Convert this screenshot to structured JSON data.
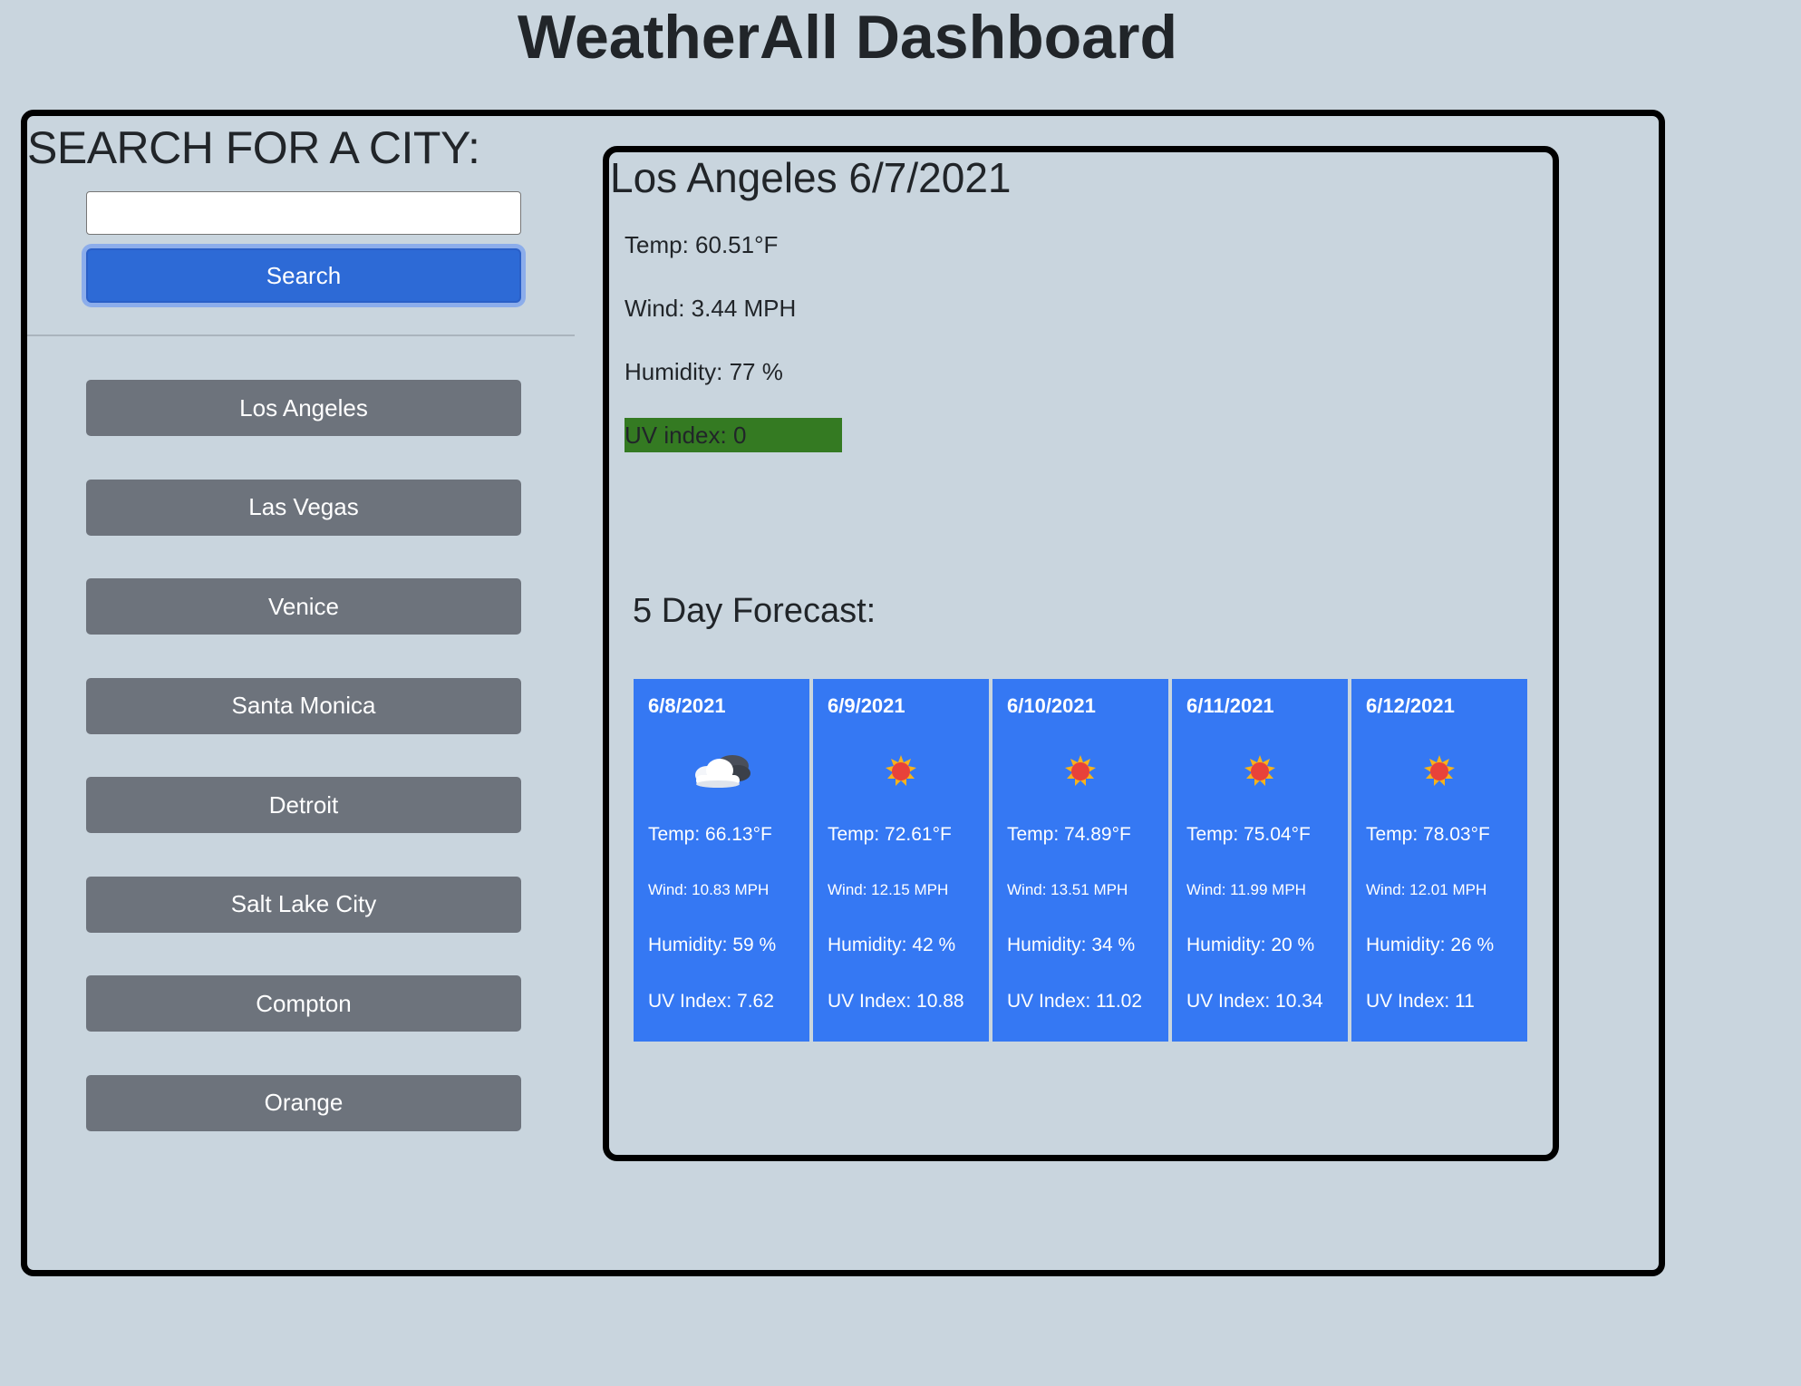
{
  "page": {
    "title": "WeatherAll Dashboard"
  },
  "search": {
    "heading": "SEARCH FOR A CITY:",
    "input_value": "",
    "input_placeholder": "",
    "button_label": "Search"
  },
  "history": [
    {
      "label": "Los Angeles"
    },
    {
      "label": "Las Vegas"
    },
    {
      "label": "Venice"
    },
    {
      "label": "Santa Monica"
    },
    {
      "label": "Detroit"
    },
    {
      "label": "Salt Lake City"
    },
    {
      "label": "Compton"
    },
    {
      "label": "Orange"
    }
  ],
  "current": {
    "heading": "Los Angeles 6/7/2021",
    "temp": "Temp: 60.51°F",
    "wind": "Wind: 3.44 MPH",
    "humidity": "Humidity: 77 %",
    "uv": "UV index: 0",
    "uv_color": "#347a22"
  },
  "forecast": {
    "heading": "5 Day Forecast:",
    "card_color": "#3578f3",
    "days": [
      {
        "date": "6/8/2021",
        "icon": "partly-cloudy-icon",
        "temp": "Temp: 66.13°F",
        "wind": "Wind: 10.83 MPH",
        "humidity": "Humidity: 59 %",
        "uv": "UV Index: 7.62"
      },
      {
        "date": "6/9/2021",
        "icon": "sun-icon",
        "temp": "Temp: 72.61°F",
        "wind": "Wind: 12.15 MPH",
        "humidity": "Humidity: 42 %",
        "uv": "UV Index: 10.88"
      },
      {
        "date": "6/10/2021",
        "icon": "sun-icon",
        "temp": "Temp: 74.89°F",
        "wind": "Wind: 13.51 MPH",
        "humidity": "Humidity: 34 %",
        "uv": "UV Index: 11.02"
      },
      {
        "date": "6/11/2021",
        "icon": "sun-icon",
        "temp": "Temp: 75.04°F",
        "wind": "Wind: 11.99 MPH",
        "humidity": "Humidity: 20 %",
        "uv": "UV Index: 10.34"
      },
      {
        "date": "6/12/2021",
        "icon": "sun-icon",
        "temp": "Temp: 78.03°F",
        "wind": "Wind: 12.01 MPH",
        "humidity": "Humidity: 26 %",
        "uv": "UV Index: 11"
      }
    ]
  },
  "colors": {
    "background": "#c9d5de",
    "search_button": "#2d6ad6",
    "history_button": "#6d737c"
  }
}
